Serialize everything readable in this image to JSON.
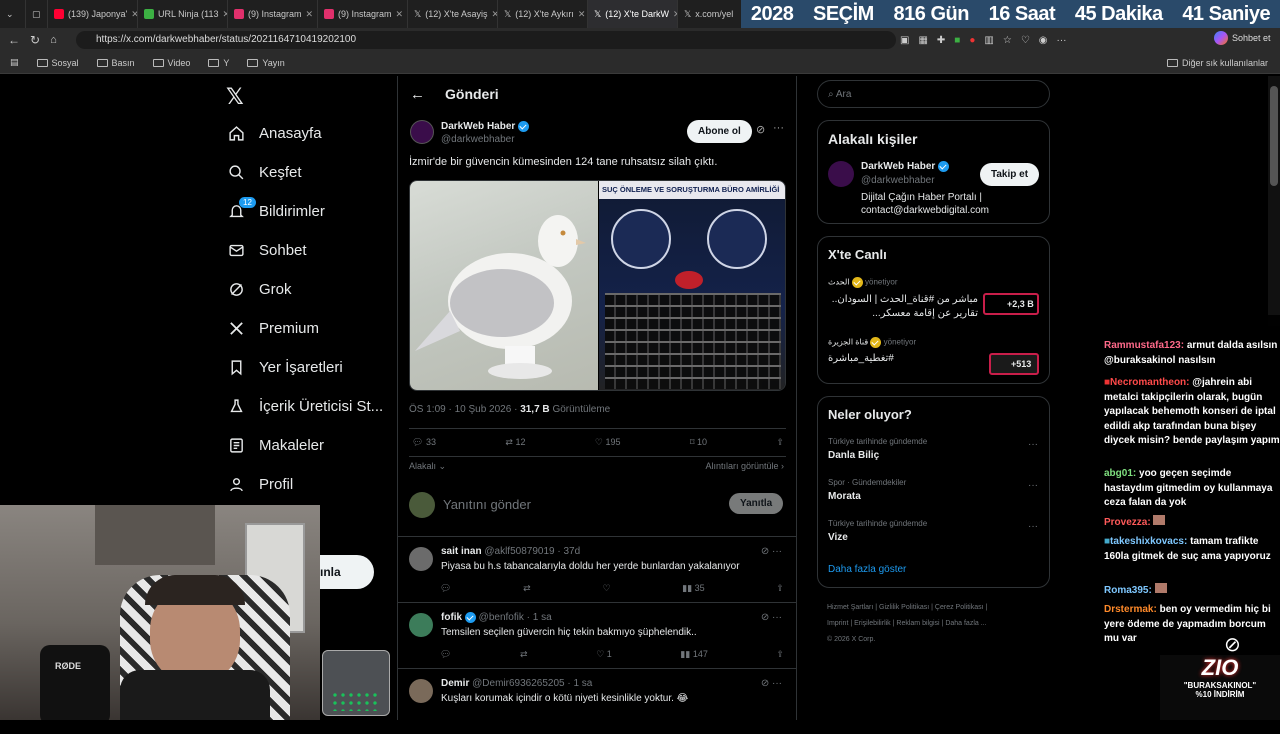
{
  "tabs": [
    {
      "label": "(139) Japonya'",
      "color": "#ff0033"
    },
    {
      "label": "URL Ninja (113",
      "color": "#3cb043"
    },
    {
      "label": "(9) Instagram",
      "color": "#e1306c"
    },
    {
      "label": "(9) Instagram",
      "color": "#e1306c"
    },
    {
      "label": "(12) X'te Asayiş",
      "color": "#ffffff"
    },
    {
      "label": "(12) X'te Aykırı",
      "color": "#ffffff"
    },
    {
      "label": "(12) X'te DarkW",
      "color": "#ffffff"
    },
    {
      "label": "x.com/yel",
      "color": "#ffffff"
    }
  ],
  "countdown": {
    "year": "2028",
    "label": "SEÇİM",
    "days": "816 Gün",
    "hours": "16 Saat",
    "minutes": "45 Dakika",
    "seconds": "41 Saniye"
  },
  "url": "https://x.com/darkwebhaber/status/2021164710419202100",
  "chat_button": "Sohbet et",
  "bookmarks": [
    "Sosyal",
    "Basın",
    "Video",
    "Y",
    "Yayın"
  ],
  "bookmarks_other": "Diğer sık kullanılanlar",
  "nav": {
    "items": [
      {
        "label": "Anasayfa",
        "icon": "home-icon"
      },
      {
        "label": "Keşfet",
        "icon": "search-icon"
      },
      {
        "label": "Bildirimler",
        "icon": "bell-icon"
      },
      {
        "label": "Sohbet",
        "icon": "mail-icon"
      },
      {
        "label": "Grok",
        "icon": "grok-icon"
      },
      {
        "label": "Premium",
        "icon": "x-icon"
      },
      {
        "label": "Yer İşaretleri",
        "icon": "bookmark-icon"
      },
      {
        "label": "İçerik Üreticisi St...",
        "icon": "flask-icon"
      },
      {
        "label": "Makaleler",
        "icon": "article-icon"
      },
      {
        "label": "Profil",
        "icon": "person-icon"
      }
    ],
    "notif_count": "12",
    "post_button_partial": "ınla"
  },
  "post": {
    "header": "Gönderi",
    "author": "DarkWeb Haber",
    "handle": "@darkwebhaber",
    "follow": "Abone ol",
    "text": "İzmir'de bir güvencin kümesinden 124 tane ruhsatsız silah çıktı.",
    "image_banner": "SUÇ ÖNLEME VE SORUŞTURMA BÜRO AMİRLİĞİ",
    "time": "ÖS 1:09 · 10 Şub 2026 ·",
    "views": "31,7 B",
    "views_label": "Görüntüleme",
    "replies": "33",
    "reposts": "12",
    "likes": "195",
    "bookmarks": "10",
    "related": "Alakalı",
    "quotes": "Alıntıları görüntüle",
    "reply_placeholder": "Yanıtını gönder",
    "reply_button": "Yanıtla"
  },
  "replies": [
    {
      "name": "sait inan",
      "handle": "@aklf50879019 · 37d",
      "text": "Piyasa bu h.s tabancalarıyla doldu her yerde bunlardan yakalanıyor",
      "reply": "",
      "repost": "",
      "like": "",
      "views": "35",
      "verified": false
    },
    {
      "name": "fofik",
      "handle": "@benfofik · 1 sa",
      "text": "Temsilen seçilen güvercin hiç tekin bakmıyo şüphelendik..",
      "reply": "",
      "repost": "",
      "like": "1",
      "views": "147",
      "verified": true
    },
    {
      "name": "Demir",
      "handle": "@Demir6936265205 · 1 sa",
      "text": "Kuşları korumak içindir o kötü niyeti kesinlikle yoktur. 😂",
      "reply": "",
      "repost": "",
      "like": "",
      "views": "",
      "verified": false
    }
  ],
  "search_placeholder": "Ara",
  "related_people": {
    "title": "Alakalı kişiler",
    "name": "DarkWeb Haber",
    "handle": "@darkwebhaber",
    "follow": "Takip et",
    "bio": "Dijital Çağın Haber Portalı | contact@darkwebdigital.com"
  },
  "live": {
    "title": "X'te Canlı",
    "items": [
      {
        "host": "الحدث",
        "role": "yönetiyor",
        "text": "مباشر من #قناة_الحدث | السودان.. تقارير عن إقامة معسكر...",
        "count": "+2,3 B"
      },
      {
        "host": "قناة الجزيرة",
        "role": "yönetiyor",
        "text": "#تغطية_مباشرة",
        "count": "+513"
      }
    ]
  },
  "trends": {
    "title": "Neler oluyor?",
    "items": [
      {
        "context": "Türkiye tarihinde gündemde",
        "topic": "Danla Biliç"
      },
      {
        "context": "Spor · Gündemdekiler",
        "topic": "Morata"
      },
      {
        "context": "Türkiye tarihinde gündemde",
        "topic": "Vize"
      }
    ],
    "more": "Daha fazla göster"
  },
  "footer": [
    "Hizmet Şartları",
    "Gizlilik Politikası",
    "Çerez Politikası",
    "Imprint",
    "Erişilebilirlik",
    "Reklam bilgisi",
    "Daha fazla ...",
    "© 2026 X Corp."
  ],
  "chat": [
    {
      "user": "Rammustafa123:",
      "msg": "armut dalda asılsın @buraksakinol nasılsın"
    },
    {
      "user": "Necromantheon:",
      "msg": "@jahrein abi metalci takipçilerin olarak, bugün yapılacak behemoth konseri de iptal edildi akp tarafından buna bişey diycek misin? bende paylaşım yapım"
    },
    {
      "user": "abg01:",
      "msg": "yoo geçen seçimde hastaydım gitmedim oy kullanmaya ceza falan da yok"
    },
    {
      "user": "Provezza:",
      "msg": ""
    },
    {
      "user": "takeshixkovacs:",
      "msg": "tamam trafikte 160la gitmek de suç ama yapıyoruz"
    },
    {
      "user": "Roma395:",
      "msg": ""
    },
    {
      "user": "Drstermak:",
      "msg": "ben oy vermedim hiç bi yere ödeme de yapmadım borcum mu var"
    }
  ],
  "promo": {
    "brand": "ZIO",
    "code": "\"BURAKSAKINOL\"",
    "discount": "%10 İNDİRİM"
  }
}
